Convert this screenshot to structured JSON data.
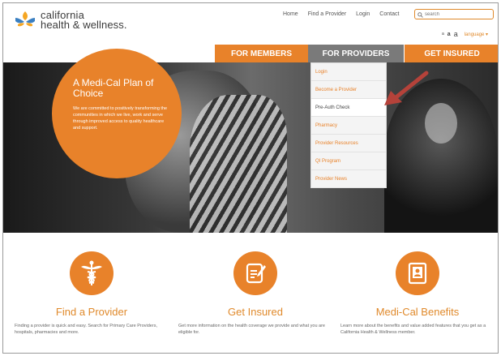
{
  "header": {
    "logo_line1": "california",
    "logo_line2": "health & wellness.",
    "topnav": [
      "Home",
      "Find a Provider",
      "Login",
      "Contact"
    ],
    "search_placeholder": "search",
    "util": {
      "text_small": "a",
      "text_medium": "a",
      "text_large": "a",
      "language": "language ▾"
    }
  },
  "mainnav": {
    "members": "FOR MEMBERS",
    "providers": "FOR PROVIDERS",
    "insured": "GET INSURED"
  },
  "hero": {
    "title": "A Medi-Cal Plan of Choice",
    "body": "We are committed to positively transforming the communities in which we live, work and serve through improved access to quality healthcare and support."
  },
  "dropdown": {
    "items": [
      "Login",
      "Become a Provider",
      "Pre-Auth Check",
      "Pharmacy",
      "Provider Resources",
      "QI Program",
      "Provider News"
    ]
  },
  "features": [
    {
      "title": "Find a Provider",
      "body": "Finding a provider is quick and easy. Search for Primary Care Providers, hospitals, pharmacies and more."
    },
    {
      "title": "Get Insured",
      "body": "Get more information on the health coverage we provide and what you are eligible for."
    },
    {
      "title": "Medi-Cal Benefits",
      "body": "Learn more about the benefits and value added features that you get as a California Health & Wellness member."
    }
  ],
  "colors": {
    "accent": "#e8822a",
    "nav_active": "#7a7a7a",
    "annotation_arrow": "#b5423a"
  },
  "icons": [
    "logo-mark",
    "search-icon",
    "caduceus-icon",
    "form-pencil-icon",
    "id-card-icon",
    "annotation-arrow"
  ]
}
